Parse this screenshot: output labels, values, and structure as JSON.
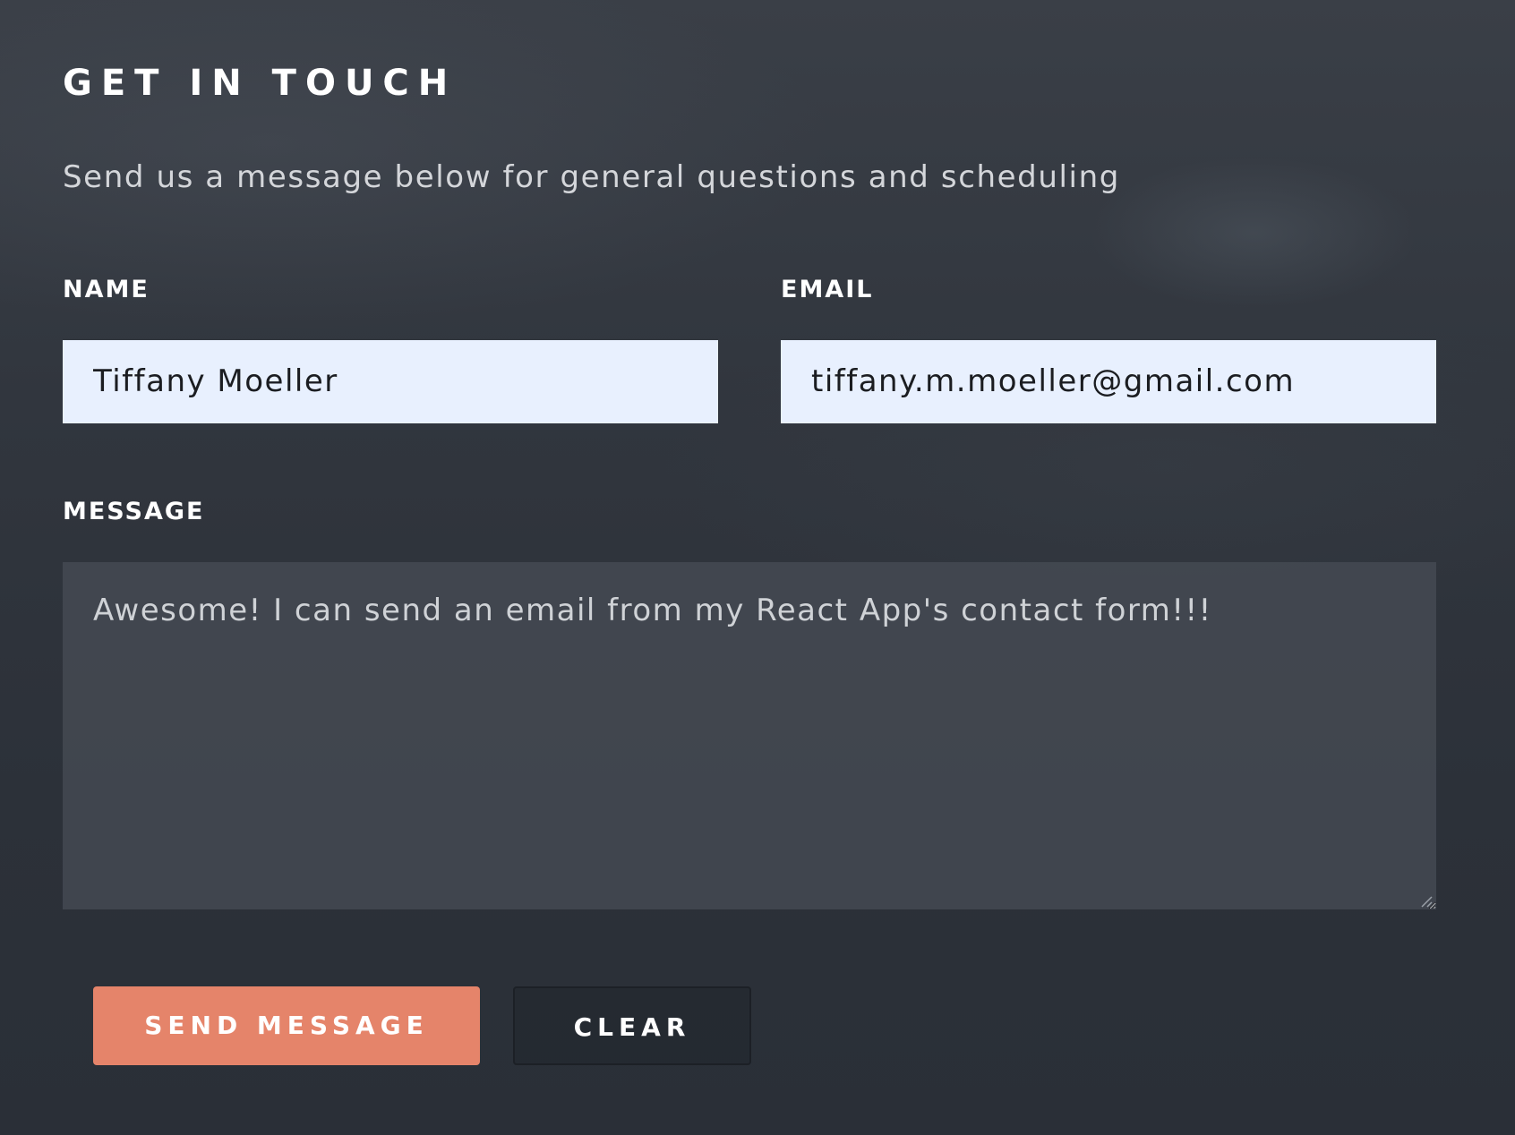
{
  "contact": {
    "title": "GET IN TOUCH",
    "subtitle": "Send us a message below for general questions and scheduling",
    "name_label": "NAME",
    "name_value": "Tiffany Moeller",
    "email_label": "EMAIL",
    "email_value": "tiffany.m.moeller@gmail.com",
    "message_label": "MESSAGE",
    "message_value": "Awesome! I can send an email from my React App's contact form!!!",
    "send_label": "SEND MESSAGE",
    "clear_label": "CLEAR"
  },
  "colors": {
    "accent": "#e5846a",
    "input_background": "#e8f0fe",
    "page_background": "#31363e"
  }
}
